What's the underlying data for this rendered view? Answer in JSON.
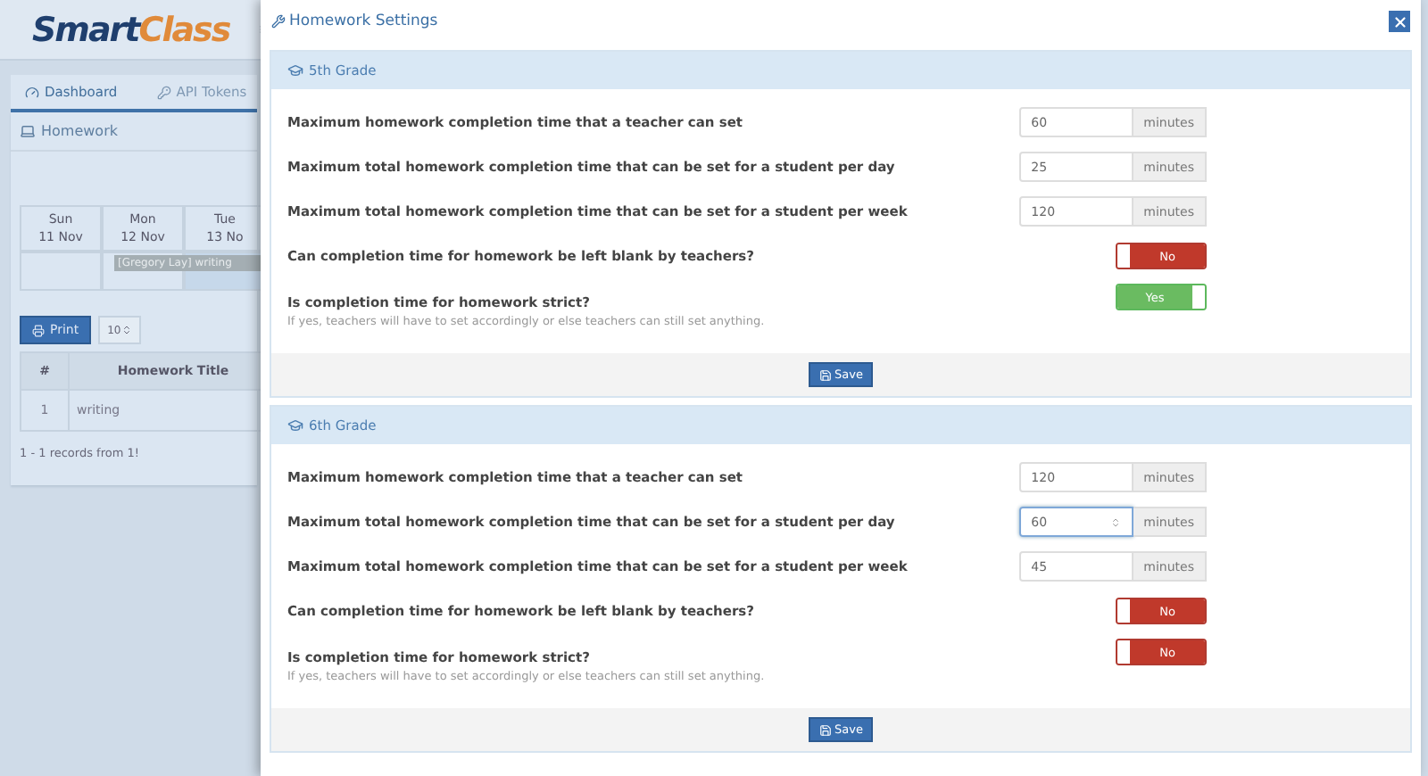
{
  "app": {
    "logo": {
      "part_1": "Smart",
      "part_2": "Class"
    },
    "tabs": [
      {
        "label": "Dashboard",
        "selected": true
      },
      {
        "label": "API Tokens",
        "selected": false
      }
    ],
    "panel_title": "Homework",
    "calendar": {
      "days": [
        {
          "name": "Sun",
          "date": "11 Nov"
        },
        {
          "name": "Mon",
          "date": "12 Nov"
        },
        {
          "name": "Tue",
          "date": "13 No"
        }
      ],
      "event": "[Gregory Lay] writing"
    },
    "print_button": "Print",
    "page_size": "10",
    "table": {
      "columns": [
        "#",
        "Homework Title"
      ],
      "rows": [
        [
          "1",
          "writing"
        ]
      ]
    },
    "footer": "1 - 1 records from 1!"
  },
  "modal": {
    "title": "Homework Settings",
    "sections": [
      {
        "title": "5th Grade",
        "fields": [
          {
            "label": "Maximum homework completion time that a teacher can set",
            "value": "60",
            "unit": "minutes",
            "focused": false
          },
          {
            "label": "Maximum total homework completion time that can be set for a student per day",
            "value": "25",
            "unit": "minutes",
            "focused": false
          },
          {
            "label": "Maximum total homework completion time that can be set for a student per week",
            "value": "120",
            "unit": "minutes",
            "focused": false
          }
        ],
        "toggles": [
          {
            "label": "Can completion time for homework be left blank by teachers?",
            "on": false,
            "text": "No"
          },
          {
            "label": "Is completion time for homework strict?",
            "on": true,
            "text": "Yes"
          }
        ],
        "help": "If yes, teachers will have to set accordingly or else teachers can still set anything.",
        "save": "Save"
      },
      {
        "title": "6th Grade",
        "fields": [
          {
            "label": "Maximum homework completion time that a teacher can set",
            "value": "120",
            "unit": "minutes",
            "focused": false
          },
          {
            "label": "Maximum total homework completion time that can be set for a student per day",
            "value": "60",
            "unit": "minutes",
            "focused": true
          },
          {
            "label": "Maximum total homework completion time that can be set for a student per week",
            "value": "45",
            "unit": "minutes",
            "focused": false
          }
        ],
        "toggles": [
          {
            "label": "Can completion time for homework be left blank by teachers?",
            "on": false,
            "text": "No"
          },
          {
            "label": "Is completion time for homework strict?",
            "on": false,
            "text": "No"
          }
        ],
        "help": "If yes, teachers will have to set accordingly or else teachers can still set anything.",
        "save": "Save"
      }
    ]
  }
}
